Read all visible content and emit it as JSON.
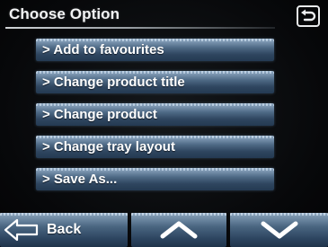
{
  "header": {
    "title": "Choose Option",
    "return_icon": "return-arrow-icon"
  },
  "menu": {
    "items": [
      {
        "label": "> Add to favourites"
      },
      {
        "label": "> Change product title"
      },
      {
        "label": "> Change product"
      },
      {
        "label": "> Change tray layout"
      },
      {
        "label": "> Save As..."
      }
    ]
  },
  "footer": {
    "back_label": "Back",
    "back_icon": "arrow-left-icon",
    "up_icon": "chevron-up-icon",
    "down_icon": "chevron-down-icon"
  },
  "colors": {
    "background": "#050607",
    "button_top": "#9fb6cb",
    "button_bottom": "#243a52",
    "text": "#ffffff"
  }
}
